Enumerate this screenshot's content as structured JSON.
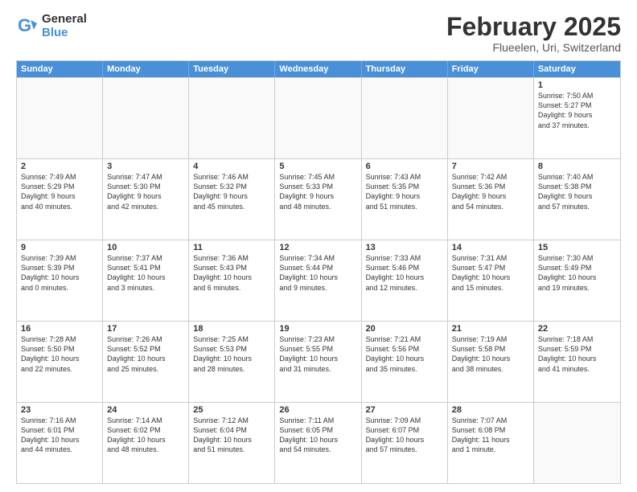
{
  "logo": {
    "general": "General",
    "blue": "Blue"
  },
  "title": "February 2025",
  "subtitle": "Flueelen, Uri, Switzerland",
  "header_days": [
    "Sunday",
    "Monday",
    "Tuesday",
    "Wednesday",
    "Thursday",
    "Friday",
    "Saturday"
  ],
  "rows": [
    [
      {
        "day": "",
        "info": "",
        "empty": true
      },
      {
        "day": "",
        "info": "",
        "empty": true
      },
      {
        "day": "",
        "info": "",
        "empty": true
      },
      {
        "day": "",
        "info": "",
        "empty": true
      },
      {
        "day": "",
        "info": "",
        "empty": true
      },
      {
        "day": "",
        "info": "",
        "empty": true
      },
      {
        "day": "1",
        "info": "Sunrise: 7:50 AM\nSunset: 5:27 PM\nDaylight: 9 hours\nand 37 minutes."
      }
    ],
    [
      {
        "day": "2",
        "info": "Sunrise: 7:49 AM\nSunset: 5:29 PM\nDaylight: 9 hours\nand 40 minutes."
      },
      {
        "day": "3",
        "info": "Sunrise: 7:47 AM\nSunset: 5:30 PM\nDaylight: 9 hours\nand 42 minutes."
      },
      {
        "day": "4",
        "info": "Sunrise: 7:46 AM\nSunset: 5:32 PM\nDaylight: 9 hours\nand 45 minutes."
      },
      {
        "day": "5",
        "info": "Sunrise: 7:45 AM\nSunset: 5:33 PM\nDaylight: 9 hours\nand 48 minutes."
      },
      {
        "day": "6",
        "info": "Sunrise: 7:43 AM\nSunset: 5:35 PM\nDaylight: 9 hours\nand 51 minutes."
      },
      {
        "day": "7",
        "info": "Sunrise: 7:42 AM\nSunset: 5:36 PM\nDaylight: 9 hours\nand 54 minutes."
      },
      {
        "day": "8",
        "info": "Sunrise: 7:40 AM\nSunset: 5:38 PM\nDaylight: 9 hours\nand 57 minutes."
      }
    ],
    [
      {
        "day": "9",
        "info": "Sunrise: 7:39 AM\nSunset: 5:39 PM\nDaylight: 10 hours\nand 0 minutes."
      },
      {
        "day": "10",
        "info": "Sunrise: 7:37 AM\nSunset: 5:41 PM\nDaylight: 10 hours\nand 3 minutes."
      },
      {
        "day": "11",
        "info": "Sunrise: 7:36 AM\nSunset: 5:43 PM\nDaylight: 10 hours\nand 6 minutes."
      },
      {
        "day": "12",
        "info": "Sunrise: 7:34 AM\nSunset: 5:44 PM\nDaylight: 10 hours\nand 9 minutes."
      },
      {
        "day": "13",
        "info": "Sunrise: 7:33 AM\nSunset: 5:46 PM\nDaylight: 10 hours\nand 12 minutes."
      },
      {
        "day": "14",
        "info": "Sunrise: 7:31 AM\nSunset: 5:47 PM\nDaylight: 10 hours\nand 15 minutes."
      },
      {
        "day": "15",
        "info": "Sunrise: 7:30 AM\nSunset: 5:49 PM\nDaylight: 10 hours\nand 19 minutes."
      }
    ],
    [
      {
        "day": "16",
        "info": "Sunrise: 7:28 AM\nSunset: 5:50 PM\nDaylight: 10 hours\nand 22 minutes."
      },
      {
        "day": "17",
        "info": "Sunrise: 7:26 AM\nSunset: 5:52 PM\nDaylight: 10 hours\nand 25 minutes."
      },
      {
        "day": "18",
        "info": "Sunrise: 7:25 AM\nSunset: 5:53 PM\nDaylight: 10 hours\nand 28 minutes."
      },
      {
        "day": "19",
        "info": "Sunrise: 7:23 AM\nSunset: 5:55 PM\nDaylight: 10 hours\nand 31 minutes."
      },
      {
        "day": "20",
        "info": "Sunrise: 7:21 AM\nSunset: 5:56 PM\nDaylight: 10 hours\nand 35 minutes."
      },
      {
        "day": "21",
        "info": "Sunrise: 7:19 AM\nSunset: 5:58 PM\nDaylight: 10 hours\nand 38 minutes."
      },
      {
        "day": "22",
        "info": "Sunrise: 7:18 AM\nSunset: 5:59 PM\nDaylight: 10 hours\nand 41 minutes."
      }
    ],
    [
      {
        "day": "23",
        "info": "Sunrise: 7:16 AM\nSunset: 6:01 PM\nDaylight: 10 hours\nand 44 minutes."
      },
      {
        "day": "24",
        "info": "Sunrise: 7:14 AM\nSunset: 6:02 PM\nDaylight: 10 hours\nand 48 minutes."
      },
      {
        "day": "25",
        "info": "Sunrise: 7:12 AM\nSunset: 6:04 PM\nDaylight: 10 hours\nand 51 minutes."
      },
      {
        "day": "26",
        "info": "Sunrise: 7:11 AM\nSunset: 6:05 PM\nDaylight: 10 hours\nand 54 minutes."
      },
      {
        "day": "27",
        "info": "Sunrise: 7:09 AM\nSunset: 6:07 PM\nDaylight: 10 hours\nand 57 minutes."
      },
      {
        "day": "28",
        "info": "Sunrise: 7:07 AM\nSunset: 6:08 PM\nDaylight: 11 hours\nand 1 minute."
      },
      {
        "day": "",
        "info": "",
        "empty": true
      }
    ]
  ]
}
